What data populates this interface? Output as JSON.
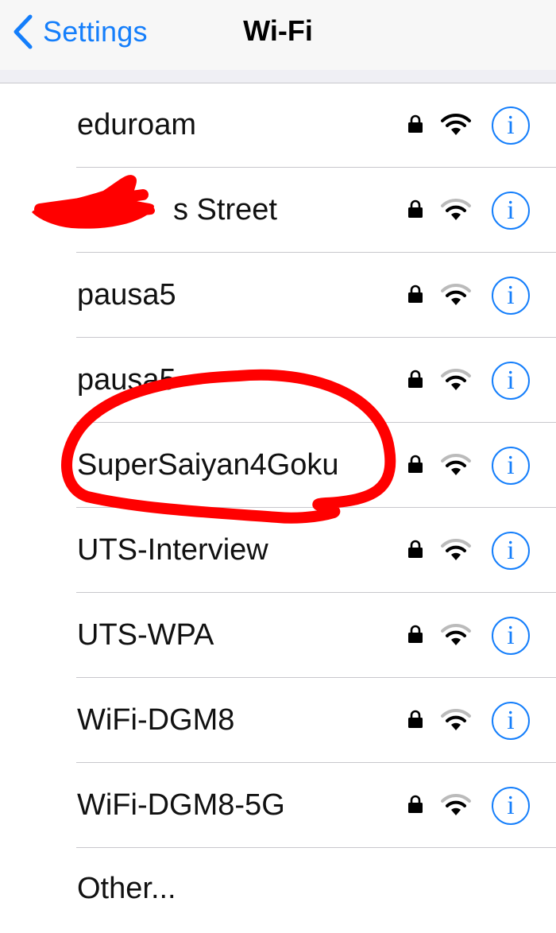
{
  "navbar": {
    "back_label": "Settings",
    "title": "Wi-Fi",
    "back_icon": "chevron-left-icon"
  },
  "networks": [
    {
      "ssid": "eduroam",
      "secured": true,
      "signal": "full"
    },
    {
      "ssid": "s Street",
      "secured": true,
      "signal": "partial"
    },
    {
      "ssid": "pausa5",
      "secured": true,
      "signal": "partial"
    },
    {
      "ssid": "pausa5",
      "secured": true,
      "signal": "partial"
    },
    {
      "ssid": "SuperSaiyan4Goku",
      "secured": true,
      "signal": "partial"
    },
    {
      "ssid": "UTS-Interview",
      "secured": true,
      "signal": "partial"
    },
    {
      "ssid": "UTS-WPA",
      "secured": true,
      "signal": "partial"
    },
    {
      "ssid": "WiFi-DGM8",
      "secured": true,
      "signal": "partial"
    },
    {
      "ssid": "WiFi-DGM8-5G",
      "secured": true,
      "signal": "partial"
    }
  ],
  "other_label": "Other...",
  "info_glyph": "i",
  "colors": {
    "accent": "#147efb",
    "annotation": "#ff0000",
    "separator": "#c8c7cc"
  }
}
